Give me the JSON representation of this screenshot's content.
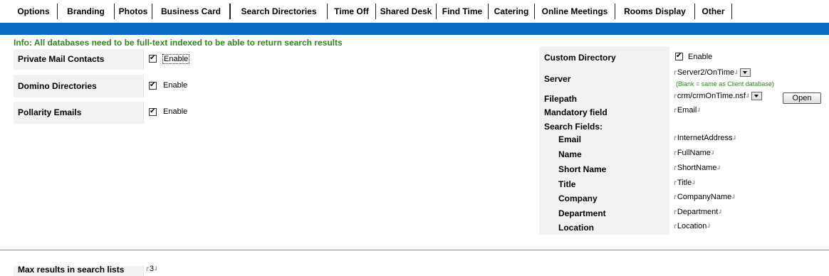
{
  "tabs": [
    {
      "label": "Options"
    },
    {
      "label": "Branding"
    },
    {
      "label": "Photos"
    },
    {
      "label": "Business Card"
    },
    {
      "label": "Search Directories"
    },
    {
      "label": "Time Off"
    },
    {
      "label": "Shared Desk"
    },
    {
      "label": "Find Time"
    },
    {
      "label": "Catering"
    },
    {
      "label": "Online Meetings"
    },
    {
      "label": "Rooms Display"
    },
    {
      "label": "Other"
    }
  ],
  "info": "Info: All databases need to be full-text indexed to be able to return search results",
  "left": {
    "private_mail": {
      "label": "Private Mail Contacts",
      "option": "Enable"
    },
    "domino": {
      "label": "Domino Directories",
      "option": "Enable"
    },
    "pollarity": {
      "label": "Pollarity Emails",
      "option": "Enable"
    }
  },
  "right": {
    "custom": {
      "label": "Custom Directory",
      "option": "Enable"
    },
    "server": {
      "label": "Server",
      "value": "Server2/OnTime",
      "hint": "(Blank = same as Client database)"
    },
    "filepath": {
      "label": "Filepath",
      "value": "crm/crmOnTime.nsf",
      "button": "Open"
    },
    "mandatory": {
      "label": "Mandatory field",
      "value": "Email"
    },
    "search_fields_label": "Search Fields:",
    "fields": [
      {
        "label": "Email",
        "value": "InternetAddress"
      },
      {
        "label": "Name",
        "value": "FullName"
      },
      {
        "label": "Short Name",
        "value": "ShortName"
      },
      {
        "label": "Title",
        "value": "Title"
      },
      {
        "label": "Company",
        "value": "CompanyName"
      },
      {
        "label": "Department",
        "value": "Department"
      },
      {
        "label": "Location",
        "value": "Location"
      }
    ]
  },
  "max_results": {
    "label": "Max results in search lists",
    "value": "3"
  },
  "glyphs": {
    "field_open": "┏",
    "field_close": "┛"
  }
}
